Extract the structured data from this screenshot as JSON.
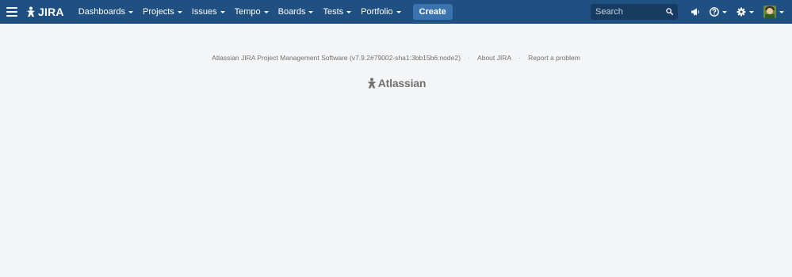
{
  "header": {
    "logo_text": "JIRA",
    "nav": [
      {
        "label": "Dashboards"
      },
      {
        "label": "Projects"
      },
      {
        "label": "Issues"
      },
      {
        "label": "Tempo"
      },
      {
        "label": "Boards"
      },
      {
        "label": "Tests"
      },
      {
        "label": "Portfolio"
      }
    ],
    "create_label": "Create",
    "search": {
      "placeholder": "Search"
    }
  },
  "footer": {
    "version_text": "Atlassian JIRA Project Management Software (v7.9.2#79002-sha1:3bb15b6:node2)",
    "about_label": "About JIRA",
    "report_label": "Report a problem",
    "separator": "·",
    "brand_text": "Atlassian"
  },
  "colors": {
    "header_bg": "#205081",
    "create_bg": "#3b73af",
    "page_bg": "#f4f5f7"
  }
}
